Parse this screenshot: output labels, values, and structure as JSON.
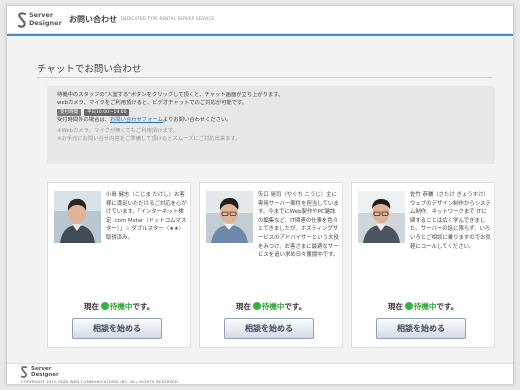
{
  "header": {
    "logo_line1": "Server",
    "logo_line2": "Designer",
    "page_title": "お問い合わせ",
    "page_subtitle": "DEDICATED TYPE RENTAL SERVER SERVICE"
  },
  "main": {
    "title": "チャットでお問い合わせ",
    "info": {
      "line1": "待機中のスタッフの\"入室する\"ボタンをクリックして頂くと、チャット画面が立ち上がります。",
      "line2": "webカメラ、マイクをご利用頂けると、ビデオチャットでのご対応が可能です。",
      "hours_label": "受付時間",
      "hours_value": "平日10:00～19:00",
      "line3_prefix": "受付時間外の場合は、",
      "line3_link": "お問い合わせフォーム",
      "line3_suffix": "よりお問い合わせください。",
      "note1": "※Webカメラ、マイクが無くてもご利用頂けます。",
      "note2": "※お手元にお問い合せ内容をご準備して頂けるとスムーズにご対応出来ます。"
    }
  },
  "staff": [
    {
      "bio": "小島 健志（こじま たけし）お客様に満足いただけるご対応を心がけています。「インターネット検定 .com Mstar（ドットコムマスター）」☆ ダブルスター（★★）取得済み。",
      "status_prefix": "現在",
      "status_value": "待機中",
      "status_suffix": "です。",
      "button_label": "相談を始める"
    },
    {
      "bio": "矢口 晃司（やぐち こうじ）主に専用サーバー案件を担当しています。今までにWeb製作やPC雑誌の編集など、IT関連の仕事を色々とてきましたが、ホスティングサービスのアドバイザーという大役をみつけ、お客さまに最適なサービスを追い求め日々奮闘中です。",
      "status_prefix": "現在",
      "status_value": "待機中",
      "status_suffix": "です。",
      "button_label": "相談を始める"
    },
    {
      "bio": "佐竹 恭輔（さたけ きょうすけ）ウェブのデザイン制作からシステム制作、ネットワークまで ITに関することは広く学んできました。サーバーの話に限らず、いろいろとご相談に乗りますのでお気軽にコールしてください。",
      "status_prefix": "現在",
      "status_value": "待機中",
      "status_suffix": "です。",
      "button_label": "相談を始める"
    }
  ],
  "footer": {
    "logo_line1": "Server",
    "logo_line2": "Designer",
    "copyright": "COPYRIGHT 2010 KDDI WEB COMMUNICATIONS INC. ALL RIGHTS RESERVED."
  },
  "colors": {
    "accent_blue": "#3d8fd1",
    "status_green": "#2fb53b",
    "link_blue": "#2a6fbd"
  }
}
